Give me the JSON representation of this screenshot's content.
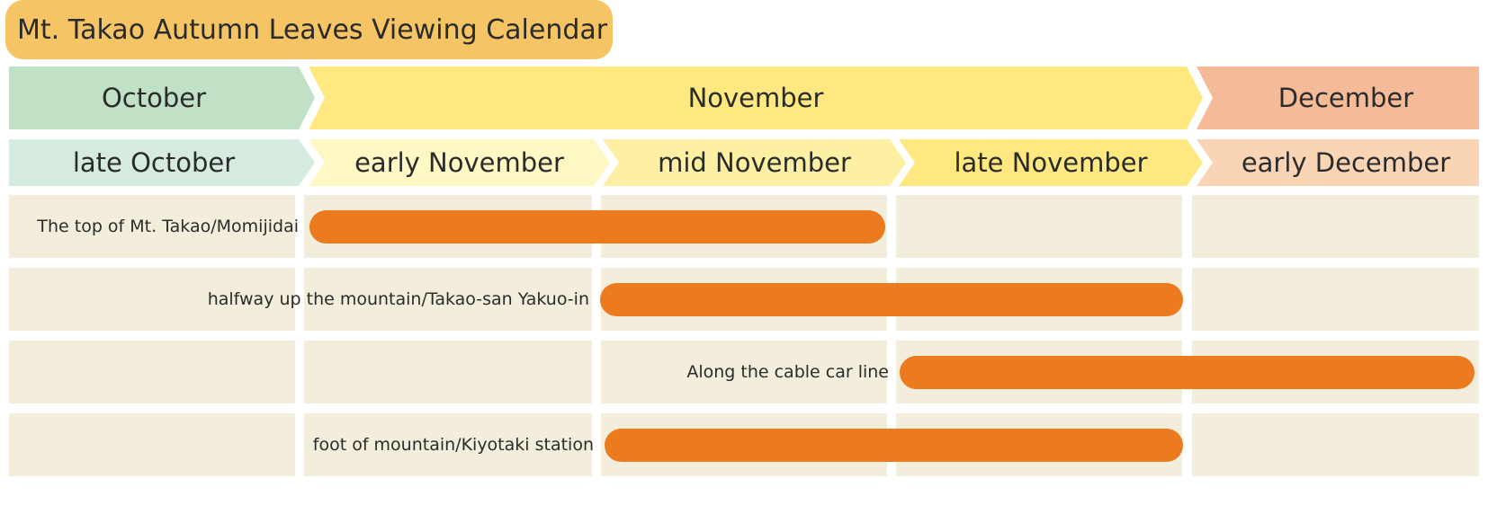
{
  "title": "Mt. Takao Autumn Leaves Viewing Calendar",
  "colors": {
    "title_bg": "#f5c465",
    "october": "#c1e1c7",
    "november": "#fee87f",
    "december": "#f5bb98",
    "late_october": "#d6ebe0",
    "early_november": "#fff8c4",
    "mid_november": "#fef0a2",
    "late_november": "#fee87f",
    "early_december": "#f9d5b6",
    "cell_bg": "#f3eedc",
    "bar": "#ec7a1f"
  },
  "chart_data": {
    "type": "gantt",
    "title": "Mt. Takao Autumn Leaves Viewing Calendar",
    "months": [
      {
        "label": "October",
        "periods": 1
      },
      {
        "label": "November",
        "periods": 3
      },
      {
        "label": "December",
        "periods": 1
      }
    ],
    "periods": [
      "late October",
      "early November",
      "mid November",
      "late November",
      "early December"
    ],
    "rows": [
      {
        "label": "The top of Mt. Takao/Momijidai",
        "start": 1,
        "end": 2
      },
      {
        "label": "halfway up the mountain/Takao-san Yakuo-in",
        "start": 2,
        "end": 3
      },
      {
        "label": "Along the cable car line",
        "start": 3,
        "end": 4
      },
      {
        "label": "foot of mountain/Kiyotaki station",
        "start": 2,
        "end": 3
      }
    ]
  }
}
